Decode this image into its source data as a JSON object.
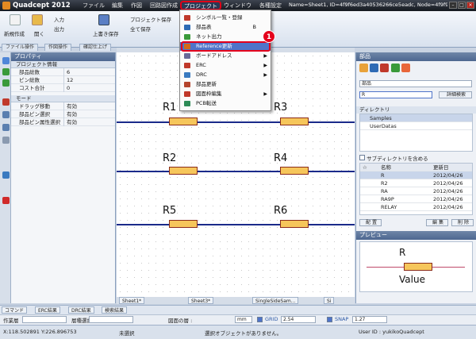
{
  "app": {
    "title": "Quadcept 2012",
    "window_info": "Name=Sheet1, ID=4f9f6ed3a40536266ce5eadc, Node=4f9f9dea..."
  },
  "menu": [
    "ファイル",
    "編集",
    "作図",
    "回路図作成",
    "プロジェクト",
    "ウィンドウ",
    "各種設定"
  ],
  "ribbon": {
    "new": "新規作成",
    "open": "開く",
    "input": "入力",
    "output": "出力",
    "overwrite_save": "上書き保存",
    "project_save": "プロジェクト保存",
    "save_all": "全て保存"
  },
  "ribbon_tabs": [
    "ファイル操作",
    "作図操作",
    "確認仕上げ"
  ],
  "dropdown": {
    "items": [
      {
        "label": "シンボル一覧・登録",
        "icon": "symbol-list-icon",
        "color": "#c0392b"
      },
      {
        "label": "部品表",
        "icon": "bom-icon",
        "key": "B",
        "color": "#2e6bb5"
      },
      {
        "label": "ネット出力",
        "icon": "net-output-icon",
        "color": "#3a9a3a"
      },
      {
        "label": "Reference更新",
        "icon": "reference-update-icon",
        "color": "#d36a1a",
        "highlight": true
      },
      {
        "label": "ボードアドレス",
        "icon": "board-address-icon",
        "color": "#6a6a9a",
        "arrow": true
      },
      {
        "label": "ERC",
        "icon": "erc-icon",
        "color": "#c0392b",
        "arrow": true
      },
      {
        "label": "DRC",
        "icon": "drc-icon",
        "color": "#3a7ac0",
        "arrow": true
      },
      {
        "label": "部品更新",
        "icon": "part-update-icon",
        "color": "#b5452e"
      },
      {
        "label": "図面枠編集",
        "icon": "frame-edit-icon",
        "color": "#c0392b",
        "arrow": true
      },
      {
        "label": "PCB転送",
        "icon": "pcb-transfer-icon",
        "color": "#2e8b57"
      }
    ]
  },
  "callout": {
    "number": "1"
  },
  "properties": {
    "title": "プロパティ",
    "sections": [
      {
        "name": "プロジェクト情報",
        "rows": [
          [
            "部品総数",
            "6"
          ],
          [
            "ピン総数",
            "12"
          ],
          [
            "コスト合計",
            "0"
          ]
        ]
      },
      {
        "name": "モード",
        "rows": [
          [
            "ドラッグ移動",
            "有効"
          ],
          [
            "部品ピン選択",
            "有効"
          ],
          [
            "部品ピン属性選択",
            "有効"
          ]
        ]
      }
    ]
  },
  "schematic": {
    "resistors": [
      "R1",
      "R2",
      "R3",
      "R4",
      "R5",
      "R6"
    ]
  },
  "parts": {
    "title": "部品",
    "category": "部品",
    "search_value": "R",
    "search_button": "詳細検索",
    "directory_title": "ディレクトリ",
    "directories": [
      "Samples",
      "UserDatas"
    ],
    "subdir_label": "サブディレクトリを含める",
    "col_star": "☆",
    "col_name": "名称",
    "col_date": "更新日",
    "rows": [
      [
        "R",
        "2012/04/26"
      ],
      [
        "R2",
        "2012/04/26"
      ],
      [
        "RA",
        "2012/04/26"
      ],
      [
        "RA9P",
        "2012/04/26"
      ],
      [
        "RELAY",
        "2012/04/26"
      ]
    ],
    "buttons": [
      "配 置",
      "編 集",
      "削 除"
    ],
    "preview_title": "プレビュー",
    "preview_name": "R",
    "preview_value": "Value"
  },
  "sheet_tabs": [
    "Sheet1*",
    "Sheet3*",
    "SingleSideSam...",
    "Si"
  ],
  "cmd_tabs": [
    "コマンド",
    "ERC結果",
    "DRC結果",
    "検索結果"
  ],
  "status1": {
    "mode_label": "作業層",
    "layer_label": "層種選択",
    "drawing_label": "図面の層 :",
    "unit": "mm",
    "grid_label": "GRID",
    "grid_value": "2.54",
    "snap_label": "SNAP",
    "snap_value": "1.27"
  },
  "status2": {
    "coords": "X:118.502891 Y:226.896753",
    "selection": "未選択",
    "message": "選択オブジェクトがありません。",
    "user": "User ID : yukikoQuadcept"
  }
}
